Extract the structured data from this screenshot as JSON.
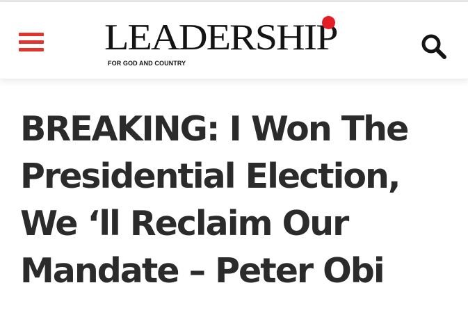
{
  "header": {
    "menu_icon": "hamburger-menu-icon",
    "logo_text": "LEADERSHIP",
    "logo_tagline": "FOR GOD AND COUNTRY",
    "search_icon": "search-icon",
    "accent_color": "#e41e26"
  },
  "article": {
    "headline": "BREAKING: I Won The Presidential Election, We ‘ll Reclaim Our Mandate – Peter Obi"
  }
}
